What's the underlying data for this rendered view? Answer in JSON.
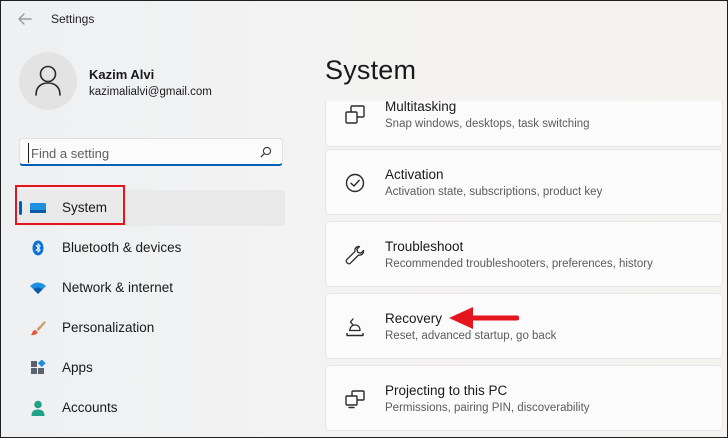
{
  "app": {
    "title": "Settings"
  },
  "profile": {
    "name": "Kazim Alvi",
    "email": "kazimalialvi@gmail.com"
  },
  "search": {
    "placeholder": "Find a setting",
    "value": ""
  },
  "nav": {
    "items": [
      {
        "label": "System",
        "icon": "system-display-icon",
        "active": true
      },
      {
        "label": "Bluetooth & devices",
        "icon": "bluetooth-icon",
        "active": false
      },
      {
        "label": "Network & internet",
        "icon": "wifi-icon",
        "active": false
      },
      {
        "label": "Personalization",
        "icon": "brush-icon",
        "active": false
      },
      {
        "label": "Apps",
        "icon": "apps-icon",
        "active": false
      },
      {
        "label": "Accounts",
        "icon": "person-icon",
        "active": false
      }
    ]
  },
  "main": {
    "title": "System",
    "cards": [
      {
        "title": "Multitasking",
        "desc": "Snap windows, desktops, task switching",
        "icon": "multitasking-icon"
      },
      {
        "title": "Activation",
        "desc": "Activation state, subscriptions, product key",
        "icon": "activation-check-icon"
      },
      {
        "title": "Troubleshoot",
        "desc": "Recommended troubleshooters, preferences, history",
        "icon": "wrench-icon"
      },
      {
        "title": "Recovery",
        "desc": "Reset, advanced startup, go back",
        "icon": "recovery-icon"
      },
      {
        "title": "Projecting to this PC",
        "desc": "Permissions, pairing PIN, discoverability",
        "icon": "projecting-icon"
      }
    ]
  },
  "colors": {
    "accent": "#005fb8",
    "annotation": "#e5151f",
    "bluetooth": "#0a6fd6",
    "accounts": "#20a286"
  }
}
